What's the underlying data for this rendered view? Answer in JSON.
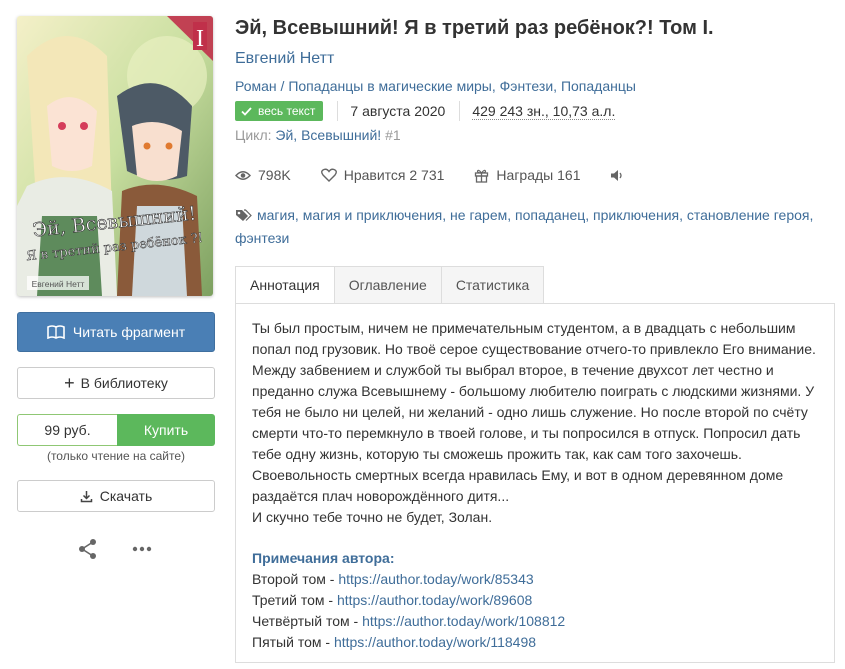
{
  "book": {
    "title": "Эй, Всевышний! Я в третий раз ребёнок?! Том I.",
    "author": "Евгений Нетт",
    "genres": [
      "Роман",
      "Попаданцы в магические миры",
      "Фэнтези",
      "Попаданцы"
    ],
    "status_badge": "весь текст",
    "date": "7 августа 2020",
    "size": "429 243 зн., 10,73 а.л.",
    "cycle_label": "Цикл:",
    "cycle_name": "Эй, Всевышний!",
    "cycle_num": "#1"
  },
  "cover": {
    "title_line1": "Эй, Всевышний!",
    "title_line2": "Я в третий раз ребёнок ?!",
    "author": "Евгений Нетт",
    "volume": "I"
  },
  "stats": {
    "views": "798K",
    "likes_label": "Нравится",
    "likes": "2 731",
    "awards_label": "Награды",
    "awards": "161"
  },
  "tags": [
    "магия",
    "магия и приключения",
    "не гарем",
    "попаданец",
    "приключения",
    "становление героя",
    "фэнтези"
  ],
  "actions": {
    "read_fragment": "Читать фрагмент",
    "add_library": "В библиотеку",
    "price": "99 руб.",
    "buy": "Купить",
    "buy_note": "(только чтение на сайте)",
    "download": "Скачать"
  },
  "tabs": [
    "Аннотация",
    "Оглавление",
    "Статистика"
  ],
  "annotation": {
    "lines": [
      "Ты был простым, ничем не примечательным студентом, а в двадцать с небольшим",
      "попал под грузовик. Но твоё серое существование отчего-то привлекло Его внимание.",
      "Между забвением и службой ты выбрал второе, в течение двухсот лет честно и",
      "преданно служа Всевышнему - большому любителю поиграть с людскими жизнями. У",
      "тебя не было ни целей, ни желаний - одно лишь служение. Но после второй по счёту",
      "смерти что-то перемкнуло в твоей голове, и ты попросился в отпуск. Попросил дать",
      "тебе одну жизнь, которую ты сможешь прожить так, как сам того захочешь.",
      "Своевольность смертных всегда нравилась Ему, и вот в одном деревянном доме",
      "раздаётся плач новорождённого дитя...",
      "И скучно тебе точно не будет, Золан."
    ],
    "notes_title": "Примечания автора:",
    "notes": [
      {
        "label": "Второй том - ",
        "url": "https://author.today/work/85343"
      },
      {
        "label": "Третий том - ",
        "url": "https://author.today/work/89608"
      },
      {
        "label": "Четвёртый том - ",
        "url": "https://author.today/work/108812"
      },
      {
        "label": "Пятый том - ",
        "url": "https://author.today/work/118498"
      }
    ]
  },
  "colors": {
    "link": "#3f6d99",
    "primary_button": "#4a7fb5",
    "buy_green": "#5cb85c",
    "cover_corner_red": "#c0304a"
  }
}
